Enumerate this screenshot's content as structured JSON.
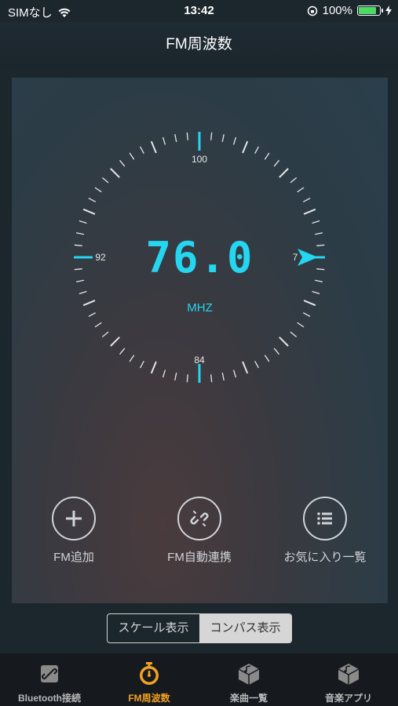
{
  "status": {
    "carrier": "SIMなし",
    "time": "13:42",
    "battery": "100%"
  },
  "header": {
    "title": "FM周波数"
  },
  "dial": {
    "frequency": "76.0",
    "unit": "MHZ",
    "labels": {
      "top": "100",
      "left": "92",
      "bottom": "84",
      "right": "7"
    },
    "accent": "#25d6f0"
  },
  "actions": [
    {
      "label": "FM追加",
      "icon": "plus-icon"
    },
    {
      "label": "FM自動連携",
      "icon": "link-icon"
    },
    {
      "label": "お気に入り一覧",
      "icon": "list-icon"
    }
  ],
  "segment": {
    "options": [
      "スケール表示",
      "コンパス表示"
    ],
    "selected": "コンパス表示"
  },
  "tabs": [
    {
      "label": "Bluetooth接続",
      "icon": "bluetooth-link-icon"
    },
    {
      "label": "FM周波数",
      "icon": "stopwatch-icon",
      "active": true
    },
    {
      "label": "楽曲一覧",
      "icon": "music-box-icon"
    },
    {
      "label": "音楽アプリ",
      "icon": "music-box-icon"
    }
  ],
  "colors": {
    "active_tab": "#f2a123",
    "battery": "#4cd964"
  }
}
